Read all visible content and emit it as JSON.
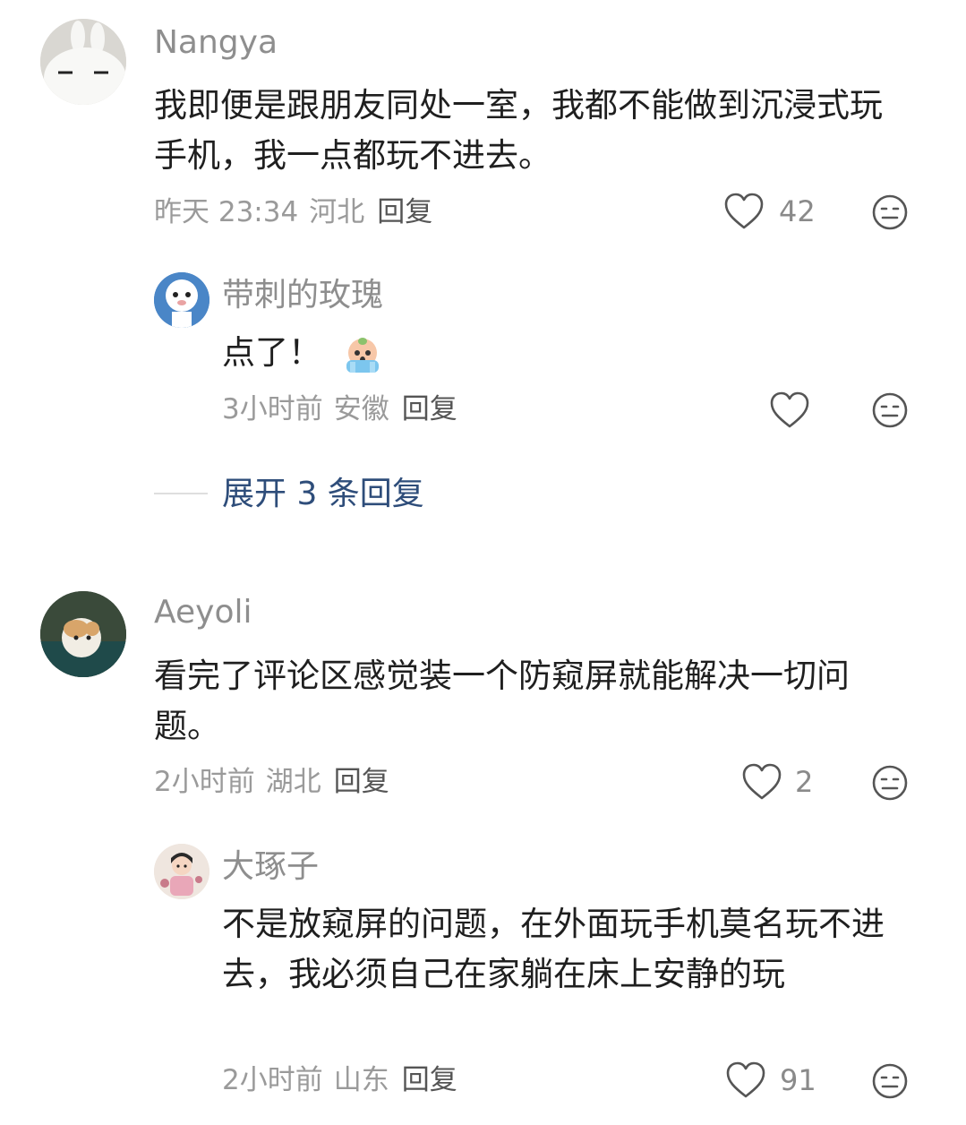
{
  "comments": [
    {
      "username": "Nangya",
      "text": "我即便是跟朋友同处一室，我都不能做到沉浸式玩手机，我一点都玩不进去。",
      "time": "昨天 23:34",
      "location": "河北",
      "reply_label": "回复",
      "likes": "42",
      "avatar": "white-rabbit-plush-icon"
    },
    {
      "username": "带刺的玫瑰",
      "text": "点了！",
      "emoji": "crying-emoji-icon",
      "time": "3小时前",
      "location": "安徽",
      "reply_label": "回复",
      "likes": "",
      "avatar": "cartoon-sheep-icon"
    },
    {
      "username": "Aeyoli",
      "text": "看完了评论区感觉装一个防窥屏就能解决一切问题。",
      "time": "2小时前",
      "location": "湖北",
      "reply_label": "回复",
      "likes": "2",
      "avatar": "hamster-plush-icon"
    },
    {
      "username": "大琢子",
      "text": "不是放窥屏的问题，在外面玩手机莫名玩不进去，我必须自己在家躺在床上安静的玩",
      "time": "2小时前",
      "location": "山东",
      "reply_label": "回复",
      "likes": "91",
      "avatar": "cartoon-girl-icon"
    }
  ],
  "expand_replies": {
    "label": "展开 3 条回复"
  },
  "colors": {
    "link": "#2e4d7a",
    "meta": "#9a9a9a",
    "text": "#1f1f1f"
  },
  "icons": {
    "like": "heart-outline-icon",
    "dislike": "meh-face-icon"
  }
}
